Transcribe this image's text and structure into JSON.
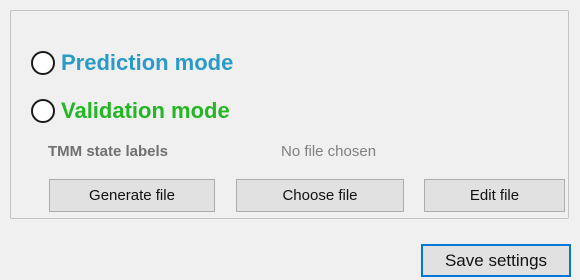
{
  "modes": {
    "prediction_label": "Prediction mode",
    "validation_label": "Validation mode",
    "selected": null
  },
  "tmm": {
    "label": "TMM state labels",
    "file_status": "No file chosen"
  },
  "buttons": {
    "generate_file": "Generate file",
    "choose_file": "Choose file",
    "edit_file": "Edit file",
    "save_settings": "Save settings"
  },
  "colors": {
    "prediction": "#2a9bc8",
    "validation": "#24b624",
    "focus_border": "#0078d7"
  }
}
